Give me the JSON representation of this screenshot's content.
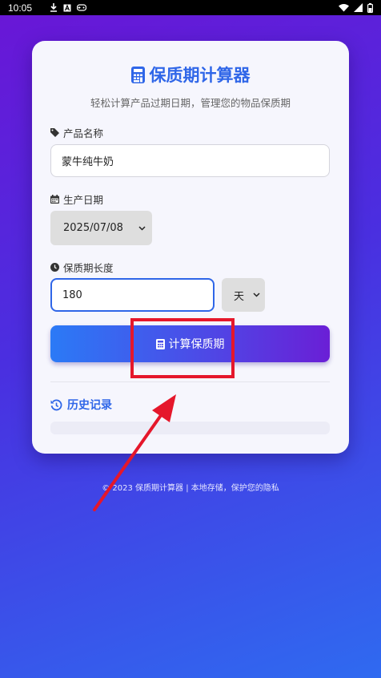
{
  "status_bar": {
    "time": "10:05"
  },
  "app": {
    "title": "保质期计算器",
    "subtitle": "轻松计算产品过期日期，管理您的物品保质期"
  },
  "form": {
    "product_label": "产品名称",
    "product_value": "蒙牛纯牛奶",
    "date_label": "生产日期",
    "date_value": "2025/07/08",
    "shelf_label": "保质期长度",
    "shelf_value": "180",
    "unit_value": "天",
    "calc_label": "计算保质期"
  },
  "history": {
    "label": "历史记录"
  },
  "footer": {
    "text": "© 2023 保质期计算器 | 本地存储，保护您的隐私"
  },
  "colors": {
    "accent": "#2f66e8",
    "annotation": "#e5172b",
    "background_start": "#6a16d6",
    "background_end": "#2f6af0"
  },
  "icons": {
    "title": "calculator-icon",
    "product": "tag-icon",
    "date": "calendar-icon",
    "shelf": "clock-icon",
    "history": "history-icon"
  }
}
